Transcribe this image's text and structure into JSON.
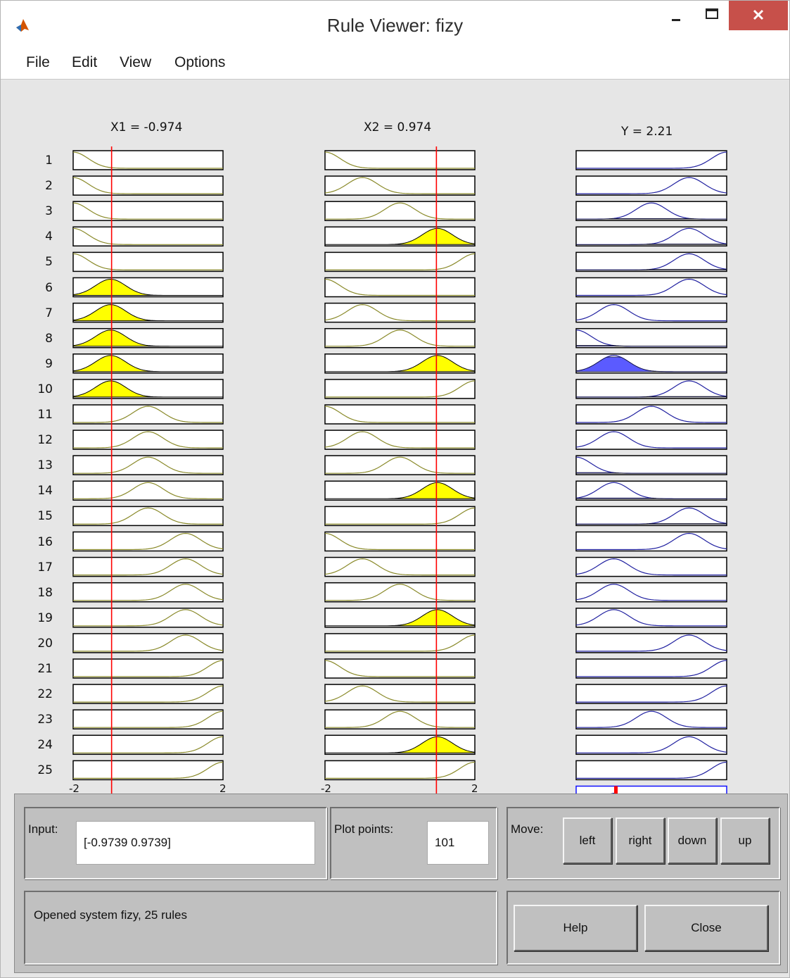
{
  "window": {
    "title": "Rule Viewer: fizy",
    "icon": "matlab-icon"
  },
  "menu": {
    "items": [
      "File",
      "Edit",
      "View",
      "Options"
    ]
  },
  "inputs": [
    {
      "label": "X1 = -0.974",
      "value": -0.974,
      "range": [
        -2,
        2
      ]
    },
    {
      "label": "X2 = 0.974",
      "value": 0.974,
      "range": [
        -2,
        2
      ]
    }
  ],
  "output": {
    "label": "Y = 2.21",
    "value": 2.21
  },
  "axis_ticks": {
    "left": "-2",
    "right": "2"
  },
  "rules": {
    "count": 25,
    "numbers": [
      "1",
      "2",
      "3",
      "4",
      "5",
      "6",
      "7",
      "8",
      "9",
      "10",
      "11",
      "12",
      "13",
      "14",
      "15",
      "16",
      "17",
      "18",
      "19",
      "20",
      "21",
      "22",
      "23",
      "24",
      "25"
    ],
    "x1_mf_index": [
      0,
      0,
      0,
      0,
      0,
      1,
      1,
      1,
      1,
      1,
      2,
      2,
      2,
      2,
      2,
      3,
      3,
      3,
      3,
      3,
      4,
      4,
      4,
      4,
      4
    ],
    "x2_mf_index": [
      0,
      1,
      2,
      3,
      4,
      0,
      1,
      2,
      3,
      4,
      0,
      1,
      2,
      3,
      4,
      0,
      1,
      2,
      3,
      4,
      0,
      1,
      2,
      3,
      4
    ],
    "y_mf_index": [
      4,
      3,
      2,
      3,
      3,
      3,
      1,
      0,
      1,
      3,
      2,
      1,
      0,
      1,
      3,
      3,
      1,
      1,
      1,
      3,
      4,
      4,
      2,
      3,
      4
    ],
    "firing_strength": [
      0,
      0,
      0,
      0,
      0,
      0,
      0,
      0,
      0.9,
      0,
      0,
      0,
      0,
      0.05,
      0,
      0,
      0,
      0,
      0,
      0,
      0,
      0,
      0,
      0,
      0
    ]
  },
  "colors": {
    "input_mf_line": "#8a8a2a",
    "input_fill": "#ffff00",
    "output_mf_line": "#2020a0",
    "output_fill": "#5b5bff",
    "value_line": "#ff0000",
    "aggregate_marker": "#ff0000"
  },
  "controls": {
    "input_label": "Input:",
    "input_value": "[-0.9739 0.9739]",
    "plot_points_label": "Plot points:",
    "plot_points_value": "101",
    "move_label": "Move:",
    "move_buttons": [
      "left",
      "right",
      "down",
      "up"
    ],
    "status": "Opened system fizy, 25 rules",
    "help_label": "Help",
    "close_label": "Close"
  }
}
